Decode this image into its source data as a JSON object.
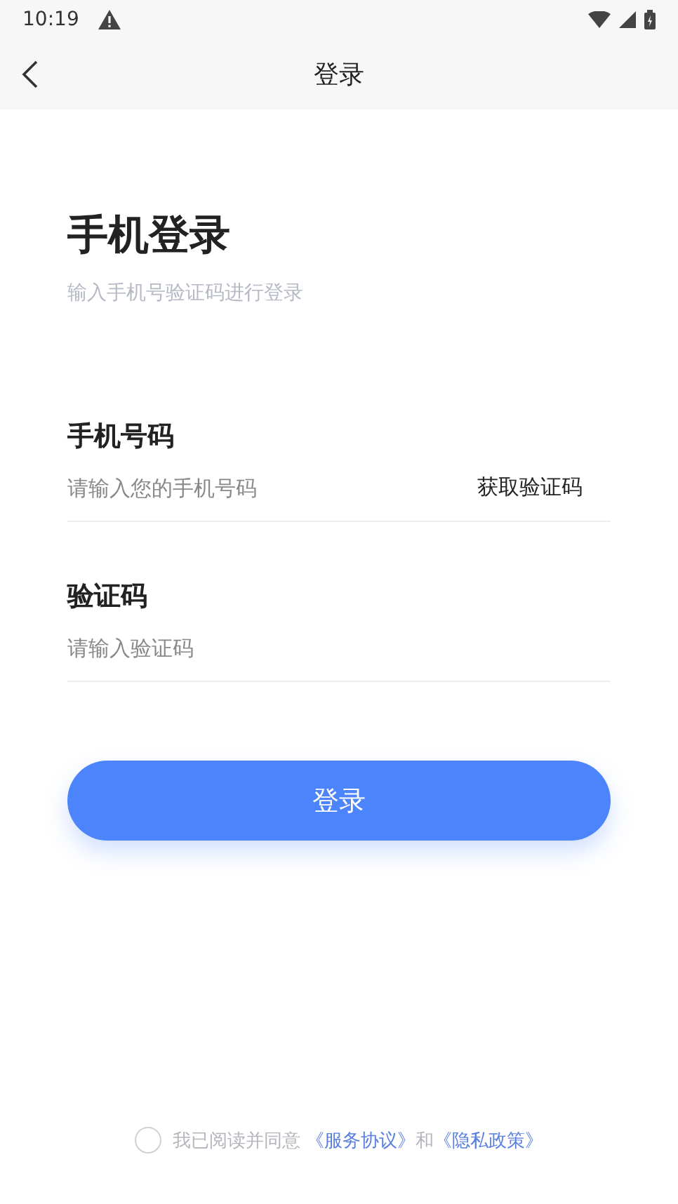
{
  "status_bar": {
    "time": "10:19"
  },
  "header": {
    "title": "登录"
  },
  "heading": {
    "title": "手机登录",
    "subtitle": "输入手机号验证码进行登录"
  },
  "fields": [
    {
      "label": "手机号码",
      "placeholder": "请输入您的手机号码",
      "action": "获取验证码"
    },
    {
      "label": "验证码",
      "placeholder": "请输入验证码"
    }
  ],
  "submit": "登录",
  "agreement": {
    "checked": false,
    "text": "我已阅读并同意",
    "link_1": "《服务协议》",
    "joiner": "和",
    "link_2": "《隐私政策》"
  }
}
